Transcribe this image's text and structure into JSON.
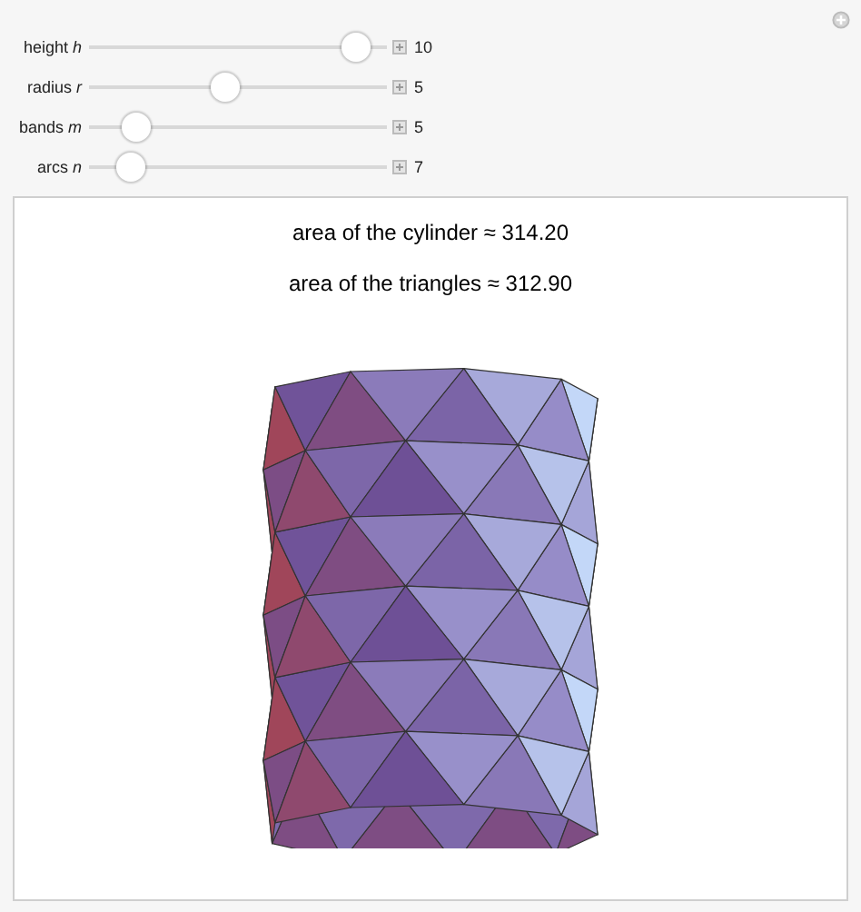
{
  "controls": [
    {
      "label": "height *h*",
      "level": 0.94,
      "value": "10"
    },
    {
      "label": "radius *r*",
      "level": 0.45,
      "value": "5"
    },
    {
      "label": "bands *m*",
      "level": 0.12,
      "value": "5"
    },
    {
      "label": "arcs *n*",
      "level": 0.1,
      "value": "7"
    }
  ],
  "output": {
    "lines": [
      "area of the cylinder ≈ 314.20",
      "area of the triangles ≈ 312.90"
    ],
    "kind": "picture"
  }
}
